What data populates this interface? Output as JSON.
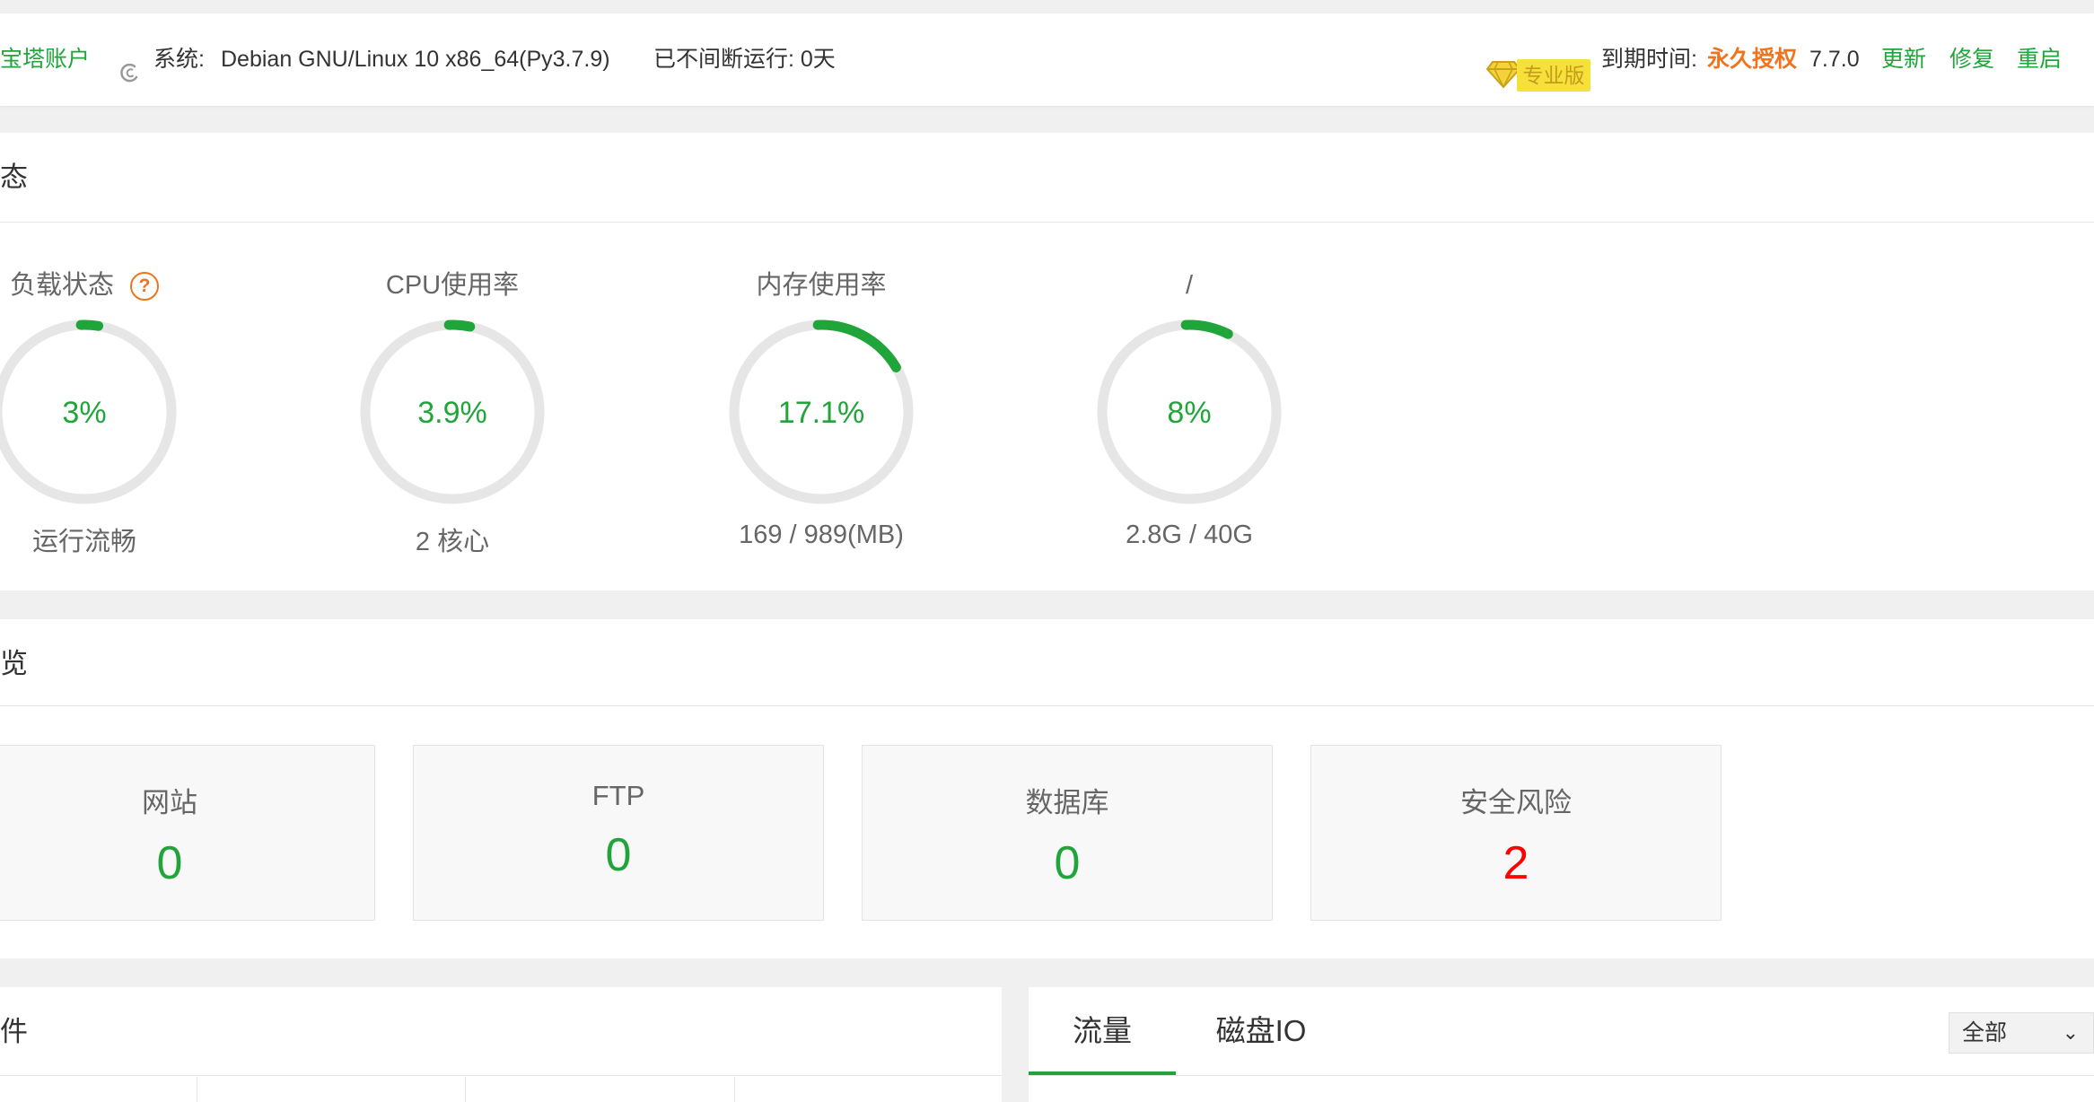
{
  "header": {
    "account_link": "宝塔账户",
    "system_label": "系统:",
    "system_value": "Debian GNU/Linux 10 x86_64(Py3.7.9)",
    "uptime": "已不间断运行: 0天",
    "pro_badge": "专业版",
    "expire_label": "到期时间:",
    "expire_value": "永久授权",
    "version": "7.7.0",
    "update_link": "更新",
    "repair_link": "修复",
    "restart_link": "重启"
  },
  "status": {
    "title": "态",
    "gauges": [
      {
        "title": "负载状态",
        "value_text": "3%",
        "percent": 3,
        "detail": "运行流畅"
      },
      {
        "title": "CPU使用率",
        "value_text": "3.9%",
        "percent": 3.9,
        "detail": "2 核心"
      },
      {
        "title": "内存使用率",
        "value_text": "17.1%",
        "percent": 17.1,
        "detail": "169 / 989(MB)"
      },
      {
        "title": "/",
        "value_text": "8%",
        "percent": 8,
        "detail": "2.8G / 40G"
      }
    ]
  },
  "overview": {
    "title": "览",
    "cards": [
      {
        "label": "网站",
        "value": "0"
      },
      {
        "label": "FTP",
        "value": "0"
      },
      {
        "label": "数据库",
        "value": "0"
      },
      {
        "label": "安全风险",
        "value": "2"
      }
    ]
  },
  "software": {
    "title": "件"
  },
  "traffic": {
    "tabs": [
      "流量",
      "磁盘IO"
    ],
    "select_value": "全部"
  },
  "colors": {
    "accent": "#20a53a",
    "warning": "#f0741e",
    "danger": "#ff0000",
    "gauge_track": "#e6e6e6"
  }
}
